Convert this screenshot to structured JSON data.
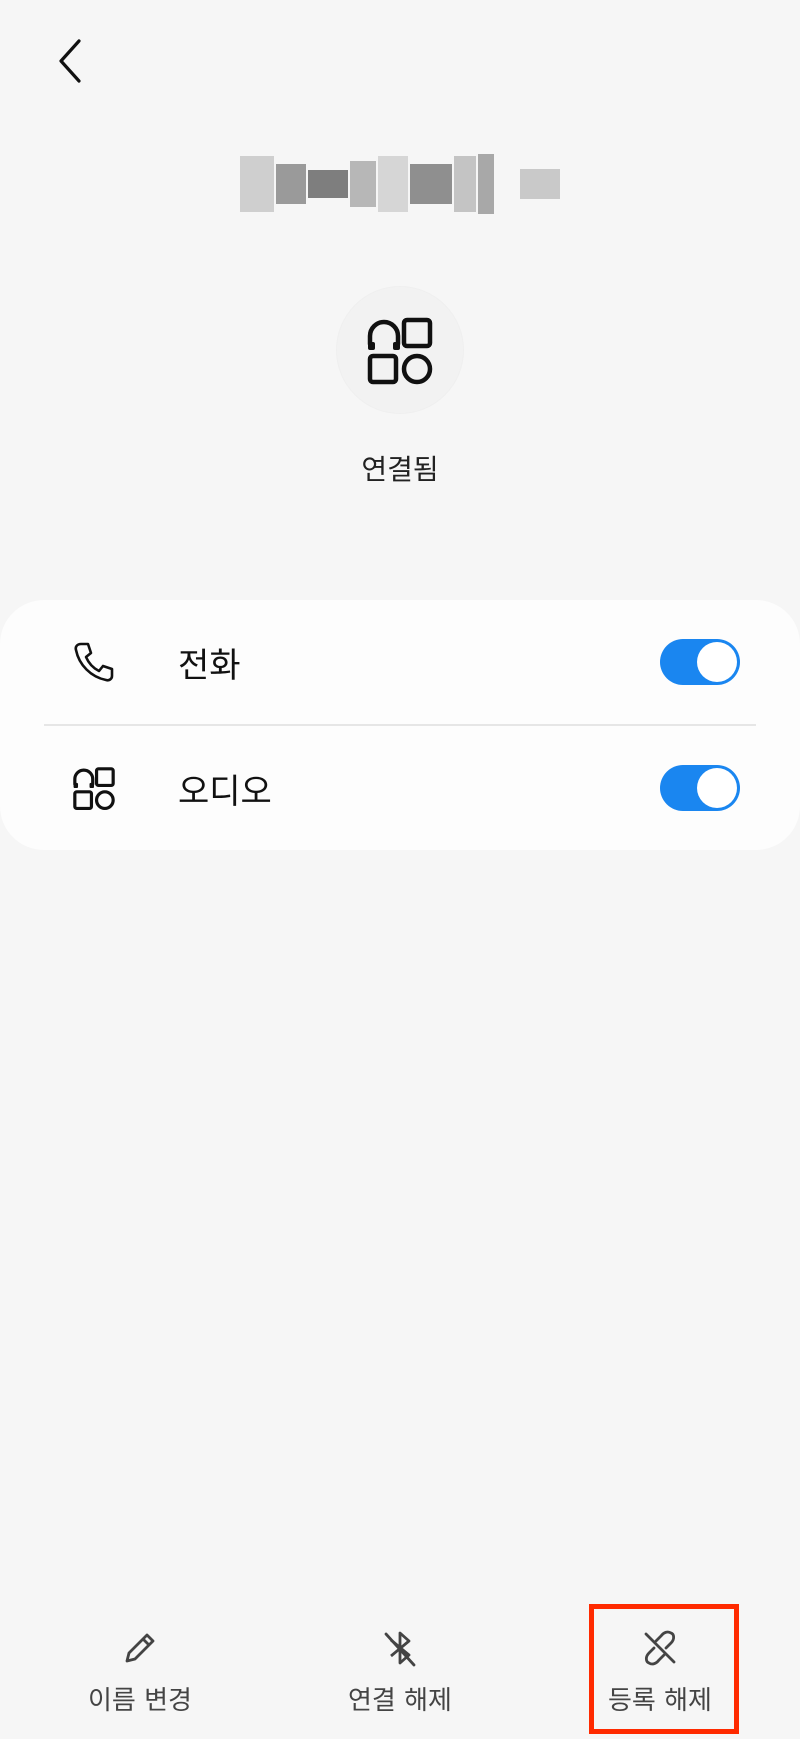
{
  "header": {
    "device_name_redacted": true
  },
  "device": {
    "status": "연결됨"
  },
  "profiles": [
    {
      "label": "전화",
      "enabled": true
    },
    {
      "label": "오디오",
      "enabled": true
    }
  ],
  "bottom_actions": [
    {
      "label": "이름 변경"
    },
    {
      "label": "연결 해제"
    },
    {
      "label": "등록 해제"
    }
  ],
  "colors": {
    "accent": "#1a86f0",
    "highlight": "#ff2a00",
    "background": "#f6f6f6"
  }
}
